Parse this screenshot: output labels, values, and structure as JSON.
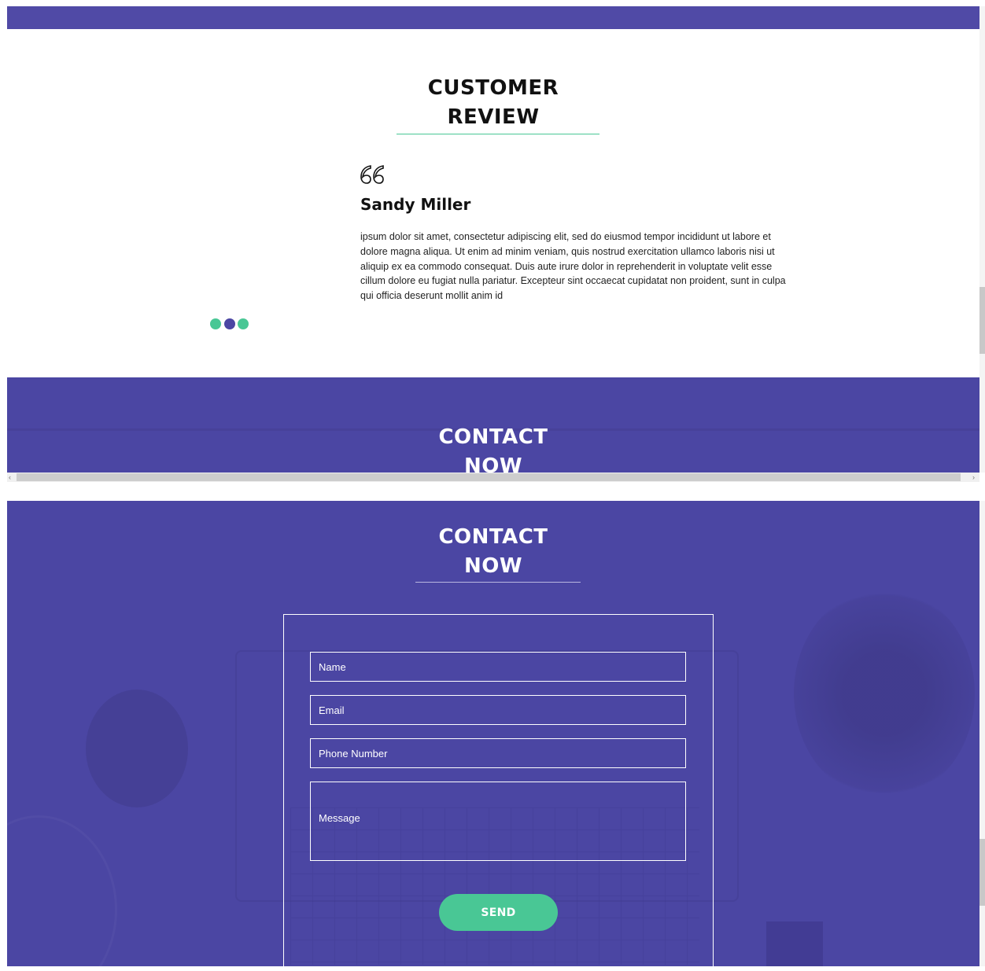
{
  "review": {
    "title_line1": "CUSTOMER",
    "title_line2": "REVIEW",
    "reviewer_name": "Sandy Miller",
    "text": "ipsum dolor sit amet, consectetur adipiscing elit, sed do eiusmod tempor incididunt ut labore et dolore magna aliqua. Ut enim ad minim veniam, quis nostrud exercitation ullamco laboris nisi ut aliquip ex ea commodo consequat. Duis aute irure dolor in reprehenderit in voluptate velit esse cillum dolore eu fugiat nulla pariatur. Excepteur sint occaecat cupidatat non proident, sunt in culpa qui officia deserunt mollit anim id",
    "quote_icon": "quote-icon",
    "carousel_dots": 3,
    "active_dot": 2
  },
  "contact": {
    "title_line1": "CONTACT",
    "title_line2": "NOW",
    "form": {
      "name_placeholder": "Name",
      "email_placeholder": "Email",
      "phone_placeholder": "Phone Number",
      "message_placeholder": "Message",
      "send_label": "SEND"
    }
  },
  "colors": {
    "brand_purple": "#4b46a3",
    "accent_green": "#49c795",
    "text_dark": "#111111"
  }
}
